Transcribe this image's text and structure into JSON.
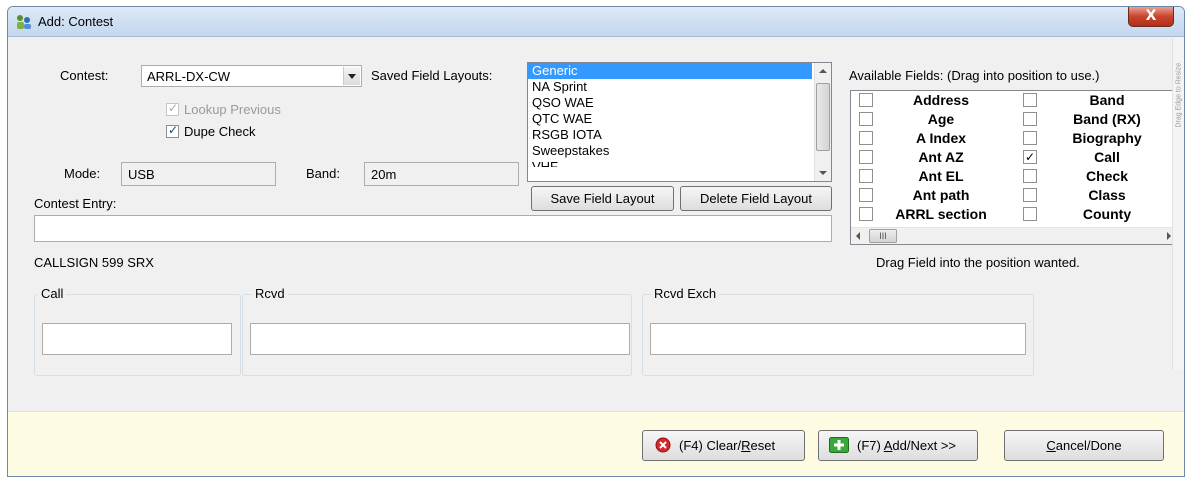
{
  "window": {
    "title": "Add: Contest",
    "close_glyph": "X"
  },
  "contest": {
    "label": "Contest:",
    "value": "ARRL-DX-CW",
    "lookup_previous": {
      "label": "Lookup Previous",
      "checked": true,
      "enabled": false
    },
    "dupe_check": {
      "label": "Dupe Check",
      "checked": true,
      "enabled": true
    }
  },
  "mode": {
    "label": "Mode:",
    "value": "USB"
  },
  "band": {
    "label": "Band:",
    "value": "20m"
  },
  "layouts": {
    "label": "Saved Field Layouts:",
    "items": [
      "Generic",
      "NA Sprint",
      "QSO WAE",
      "QTC WAE",
      "RSGB IOTA",
      "Sweepstakes",
      "VHF"
    ],
    "selected": "Generic",
    "save_label": "Save Field Layout",
    "delete_label": "Delete Field Layout"
  },
  "available_fields": {
    "label": "Available Fields:  (Drag into position to use.)",
    "hint": "Drag Field into the position wanted.",
    "left": [
      {
        "name": "Address",
        "checked": false
      },
      {
        "name": "Age",
        "checked": false
      },
      {
        "name": "A Index",
        "checked": false
      },
      {
        "name": "Ant AZ",
        "checked": false
      },
      {
        "name": "Ant EL",
        "checked": false
      },
      {
        "name": "Ant path",
        "checked": false
      },
      {
        "name": "ARRL section",
        "checked": false
      }
    ],
    "right": [
      {
        "name": "Band",
        "checked": false
      },
      {
        "name": "Band (RX)",
        "checked": false
      },
      {
        "name": "Biography",
        "checked": false
      },
      {
        "name": "Call",
        "checked": true
      },
      {
        "name": "Check",
        "checked": false
      },
      {
        "name": "Class",
        "checked": false
      },
      {
        "name": "County",
        "checked": false
      }
    ],
    "scroll_thumb_glyph": "III"
  },
  "contest_entry": {
    "label": "Contest Entry:",
    "value": ""
  },
  "exchange_format": "CALLSIGN 599 SRX",
  "entry_fields": {
    "call": {
      "label": "Call",
      "value": ""
    },
    "rcvd": {
      "label": "Rcvd",
      "value": ""
    },
    "rcvd_exch": {
      "label": "Rcvd Exch",
      "value": ""
    }
  },
  "buttons": {
    "clear_prefix": "(F4) Clear/",
    "clear_key": "R",
    "clear_suffix": "eset",
    "add_prefix": "(F7) ",
    "add_key": "A",
    "add_suffix": "dd/Next >>",
    "cancel_key": "C",
    "cancel_suffix": "ancel/Done"
  },
  "resize_hint": "Drag Edge to Resize",
  "colors": {
    "selection": "#3399ff",
    "footer_bg": "#fdfce2",
    "clear_icon": "#d9262a",
    "add_icon": "#3aa83a"
  }
}
